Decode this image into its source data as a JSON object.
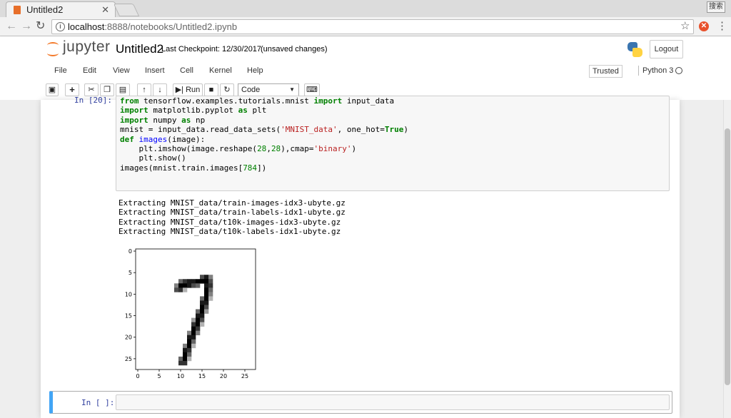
{
  "browser": {
    "tab_title": "Untitled2",
    "tab_close": "✕",
    "ime": "搜索",
    "url_host": "localhost",
    "url_path": ":8888/notebooks/Untitled2.ipynb"
  },
  "header": {
    "logo_text": "jupyter",
    "notebook_name": "Untitled2",
    "checkpoint": "Last Checkpoint: 12/30/2017",
    "unsaved": "(unsaved changes)",
    "logout_label": "Logout"
  },
  "menu": {
    "items": [
      "File",
      "Edit",
      "View",
      "Insert",
      "Cell",
      "Kernel",
      "Help"
    ],
    "trusted": "Trusted",
    "kernel_name": "Python 3"
  },
  "toolbar": {
    "run_label": "Run",
    "cell_type": "Code"
  },
  "cells": {
    "cell1_prompt": "In [20]:",
    "cell2_prompt": "In [ ]:"
  },
  "output": {
    "lines": [
      "Extracting MNIST_data/train-images-idx3-ubyte.gz",
      "Extracting MNIST_data/train-labels-idx1-ubyte.gz",
      "Extracting MNIST_data/t10k-images-idx3-ubyte.gz",
      "Extracting MNIST_data/t10k-labels-idx1-ubyte.gz"
    ]
  },
  "chart_data": {
    "type": "heatmap",
    "title": "",
    "xlabel": "",
    "ylabel": "",
    "xlim": [
      -0.5,
      27.5
    ],
    "ylim": [
      27.5,
      -0.5
    ],
    "xticks": [
      0,
      5,
      10,
      15,
      20,
      25
    ],
    "yticks": [
      0,
      5,
      10,
      15,
      20,
      25
    ],
    "cmap": "binary",
    "pixels": [
      {
        "r": 6,
        "c": 15,
        "v": 0.7
      },
      {
        "r": 6,
        "c": 16,
        "v": 0.9
      },
      {
        "r": 6,
        "c": 17,
        "v": 0.5
      },
      {
        "r": 7,
        "c": 10,
        "v": 0.6
      },
      {
        "r": 7,
        "c": 11,
        "v": 0.8
      },
      {
        "r": 7,
        "c": 12,
        "v": 0.9
      },
      {
        "r": 7,
        "c": 13,
        "v": 0.9
      },
      {
        "r": 7,
        "c": 14,
        "v": 1.0
      },
      {
        "r": 7,
        "c": 15,
        "v": 1.0
      },
      {
        "r": 7,
        "c": 16,
        "v": 1.0
      },
      {
        "r": 7,
        "c": 17,
        "v": 0.7
      },
      {
        "r": 8,
        "c": 9,
        "v": 0.5
      },
      {
        "r": 8,
        "c": 10,
        "v": 1.0
      },
      {
        "r": 8,
        "c": 11,
        "v": 1.0
      },
      {
        "r": 8,
        "c": 12,
        "v": 0.9
      },
      {
        "r": 8,
        "c": 13,
        "v": 0.7
      },
      {
        "r": 8,
        "c": 14,
        "v": 0.6
      },
      {
        "r": 8,
        "c": 16,
        "v": 0.9
      },
      {
        "r": 8,
        "c": 17,
        "v": 0.8
      },
      {
        "r": 9,
        "c": 9,
        "v": 0.7
      },
      {
        "r": 9,
        "c": 10,
        "v": 0.8
      },
      {
        "r": 9,
        "c": 11,
        "v": 0.3
      },
      {
        "r": 9,
        "c": 16,
        "v": 1.0
      },
      {
        "r": 9,
        "c": 17,
        "v": 0.6
      },
      {
        "r": 10,
        "c": 16,
        "v": 1.0
      },
      {
        "r": 10,
        "c": 17,
        "v": 0.5
      },
      {
        "r": 11,
        "c": 15,
        "v": 0.6
      },
      {
        "r": 11,
        "c": 16,
        "v": 1.0
      },
      {
        "r": 11,
        "c": 17,
        "v": 0.3
      },
      {
        "r": 12,
        "c": 15,
        "v": 0.9
      },
      {
        "r": 12,
        "c": 16,
        "v": 0.9
      },
      {
        "r": 13,
        "c": 15,
        "v": 1.0
      },
      {
        "r": 13,
        "c": 16,
        "v": 0.7
      },
      {
        "r": 14,
        "c": 14,
        "v": 0.6
      },
      {
        "r": 14,
        "c": 15,
        "v": 1.0
      },
      {
        "r": 14,
        "c": 16,
        "v": 0.4
      },
      {
        "r": 15,
        "c": 14,
        "v": 0.9
      },
      {
        "r": 15,
        "c": 15,
        "v": 0.9
      },
      {
        "r": 16,
        "c": 13,
        "v": 0.4
      },
      {
        "r": 16,
        "c": 14,
        "v": 1.0
      },
      {
        "r": 16,
        "c": 15,
        "v": 0.7
      },
      {
        "r": 17,
        "c": 13,
        "v": 0.8
      },
      {
        "r": 17,
        "c": 14,
        "v": 1.0
      },
      {
        "r": 17,
        "c": 15,
        "v": 0.3
      },
      {
        "r": 18,
        "c": 13,
        "v": 1.0
      },
      {
        "r": 18,
        "c": 14,
        "v": 0.8
      },
      {
        "r": 19,
        "c": 12,
        "v": 0.5
      },
      {
        "r": 19,
        "c": 13,
        "v": 1.0
      },
      {
        "r": 19,
        "c": 14,
        "v": 0.5
      },
      {
        "r": 20,
        "c": 12,
        "v": 0.9
      },
      {
        "r": 20,
        "c": 13,
        "v": 0.9
      },
      {
        "r": 21,
        "c": 12,
        "v": 1.0
      },
      {
        "r": 21,
        "c": 13,
        "v": 0.6
      },
      {
        "r": 22,
        "c": 11,
        "v": 0.5
      },
      {
        "r": 22,
        "c": 12,
        "v": 1.0
      },
      {
        "r": 22,
        "c": 13,
        "v": 0.3
      },
      {
        "r": 23,
        "c": 11,
        "v": 0.9
      },
      {
        "r": 23,
        "c": 12,
        "v": 0.8
      },
      {
        "r": 24,
        "c": 11,
        "v": 1.0
      },
      {
        "r": 24,
        "c": 12,
        "v": 0.6
      },
      {
        "r": 25,
        "c": 10,
        "v": 0.6
      },
      {
        "r": 25,
        "c": 11,
        "v": 1.0
      },
      {
        "r": 25,
        "c": 12,
        "v": 0.3
      },
      {
        "r": 26,
        "c": 10,
        "v": 0.8
      },
      {
        "r": 26,
        "c": 11,
        "v": 0.8
      }
    ]
  }
}
